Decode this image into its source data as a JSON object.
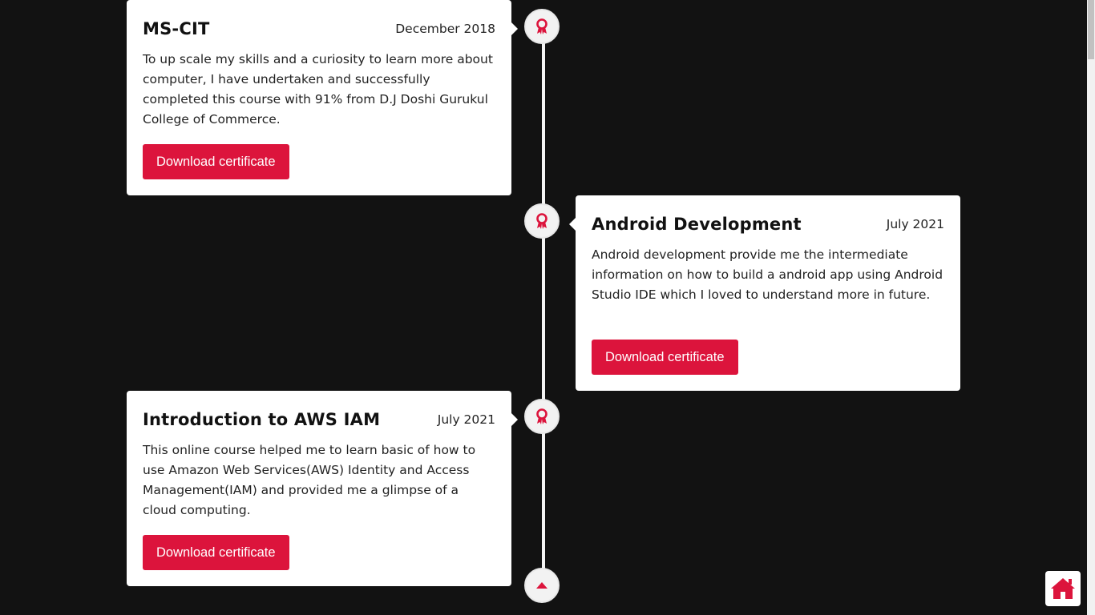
{
  "timeline": [
    {
      "title": "MS-CIT",
      "date": "December 2018",
      "description": "To up scale my skills and a curiosity to learn more about computer, I have undertaken and successfully completed this course with 91% from D.J Doshi Gurukul College of Commerce.",
      "button_label": "Download certificate",
      "icon": "award-ribbon-icon"
    },
    {
      "title": "Android Development",
      "date": "July 2021",
      "description": "Android development provide me the intermediate information on how to build a android app using Android Studio IDE which I loved to understand more in future.",
      "button_label": "Download certificate",
      "icon": "award-ribbon-icon"
    },
    {
      "title": "Introduction to AWS IAM",
      "date": "July 2021",
      "description": "This online course helped me to learn basic of how to use Amazon Web Services(AWS) Identity and Access Management(IAM) and provided me a glimpse of a cloud computing.",
      "button_label": "Download certificate",
      "icon": "award-ribbon-icon"
    }
  ],
  "end_marker_icon": "caret-up-icon",
  "home_button_icon": "home-icon",
  "colors": {
    "accent": "#dc143c",
    "background": "#121212",
    "card": "#ffffff"
  }
}
